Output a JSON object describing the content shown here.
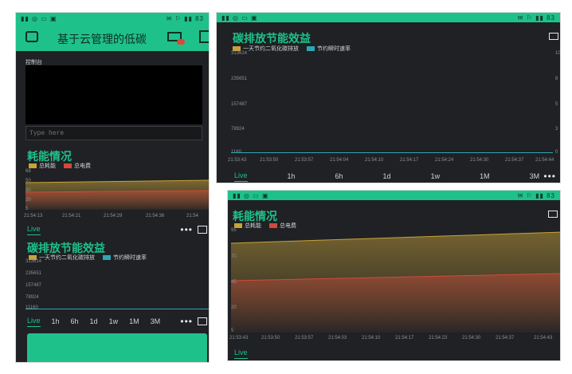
{
  "left": {
    "status_left": "▮▮ ◎ ▭ ▣",
    "status_right": "✉ ⚐ ▮▮ 83",
    "app_title": "基于云管理的低碳",
    "console_label": "控制台",
    "console_input_placeholder": "Type here",
    "energy": {
      "title": "耗能情况",
      "legend": [
        "总耗能",
        "总电费"
      ],
      "y_ticks": [
        "68",
        "50",
        "30",
        "20",
        "5"
      ],
      "x_ticks": [
        "21:54:13",
        "21:54:21",
        "21:54:29",
        "21:54:36",
        "21:54"
      ],
      "tab_live": "Live"
    },
    "carbon": {
      "title": "碳排放节能效益",
      "legend": [
        "一天节约二氧化碳排放",
        "节约瞬时速率"
      ],
      "y_ticks": [
        "313614",
        "235651",
        "157487",
        "78924",
        "11160"
      ],
      "tabs": [
        "Live",
        "1h",
        "6h",
        "1d",
        "1w",
        "1M",
        "3M"
      ]
    }
  },
  "top_right": {
    "status_left": "▮▮ ◎ ▭ ▣",
    "status_right": "✉ ⚐ ▮▮ 83",
    "title": "碳排放节能效益",
    "legend": [
      "一天节约二氧化碳排放",
      "节约瞬时速率"
    ],
    "y_ticks": [
      "313614",
      "235651",
      "157487",
      "78924",
      "1160"
    ],
    "y2_ticks": [
      "10",
      "8",
      "5",
      "3",
      "0"
    ],
    "x_ticks": [
      "21:53:43",
      "21:53:50",
      "21:53:57",
      "21:54:04",
      "21:54:10",
      "21:54:17",
      "21:54:24",
      "21:54:30",
      "21:54:37",
      "21:54:44"
    ],
    "tabs": [
      "Live",
      "1h",
      "6h",
      "1d",
      "1w",
      "1M",
      "3M"
    ]
  },
  "bottom_right": {
    "status_left": "▮▮ ◎ ▭ ▣",
    "status_right": "✉ ⚐ ▮▮ 83",
    "title": "耗能情况",
    "legend": [
      "总耗能",
      "总电费"
    ],
    "y_ticks": [
      "95",
      "70",
      "45",
      "20",
      "5"
    ],
    "x_ticks": [
      "21:53:43",
      "21:53:50",
      "21:53:57",
      "21:54:03",
      "21:54:10",
      "21:54:17",
      "21:54:23",
      "21:54:30",
      "21:54:37",
      "21:54:43"
    ],
    "tab_live": "Live"
  },
  "colors": {
    "accent": "#1fc18a",
    "panel_bg": "#1f2124",
    "energy_line": "#c8a23a",
    "fee_line": "#d24a3c",
    "carbon_line": "#2fa6b8"
  },
  "chart_data": [
    {
      "type": "area",
      "title": "耗能情况",
      "x": [
        "21:53:43",
        "21:54:43"
      ],
      "series": [
        {
          "name": "总耗能",
          "values": [
            59,
            76
          ]
        },
        {
          "name": "总电费",
          "values": [
            42,
            52
          ]
        }
      ],
      "ylim": [
        5,
        95
      ]
    },
    {
      "type": "line",
      "title": "碳排放节能效益",
      "x": [
        "21:53:43",
        "21:54:44"
      ],
      "series": [
        {
          "name": "一天节约二氧化碳排放",
          "values": [
            1160,
            1160
          ]
        },
        {
          "name": "节约瞬时速率",
          "values": [
            0,
            0
          ]
        }
      ],
      "ylim": [
        1160,
        313614
      ]
    }
  ]
}
